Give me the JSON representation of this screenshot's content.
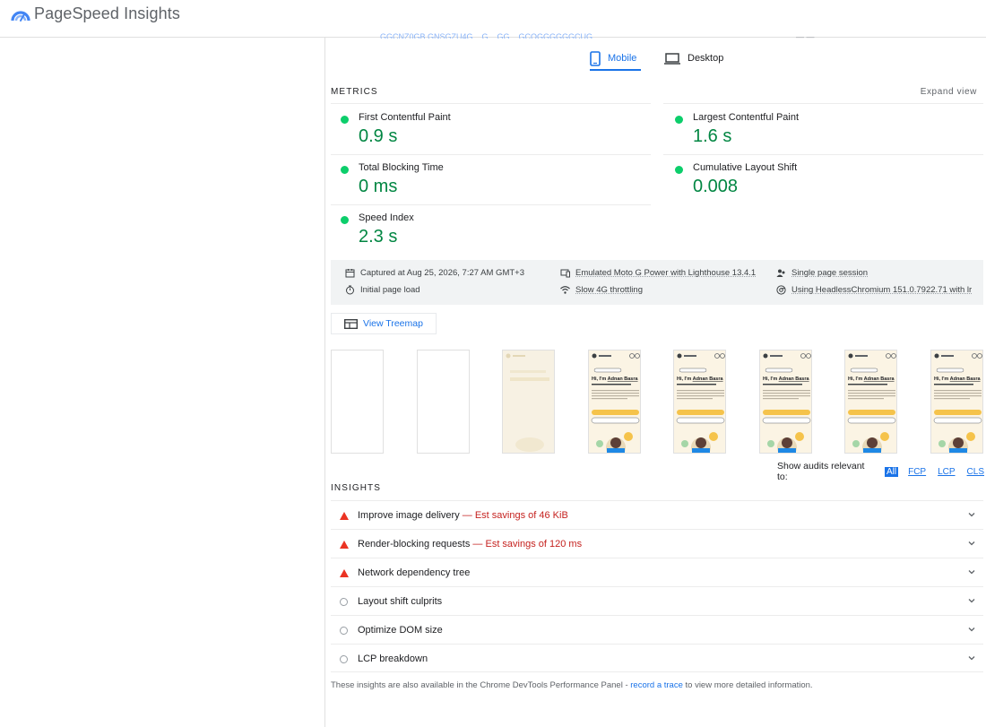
{
  "app": {
    "title": "PageSpeed Insights"
  },
  "top_clipped": {
    "left_text": "GGCNZ0GB GNSGZU4G... G... GG... GCOGGGGGGCUG...",
    "right_text": "— —"
  },
  "tabs": [
    {
      "label": "Mobile",
      "icon": "phone-icon",
      "active": true
    },
    {
      "label": "Desktop",
      "icon": "laptop-icon",
      "active": false
    }
  ],
  "metrics_section": {
    "label": "METRICS",
    "expand_label": "Expand view",
    "items": [
      {
        "label": "First Contentful Paint",
        "value": "0.9 s",
        "status": "pass"
      },
      {
        "label": "Largest Contentful Paint",
        "value": "1.6 s",
        "status": "pass"
      },
      {
        "label": "Total Blocking Time",
        "value": "0 ms",
        "status": "pass"
      },
      {
        "label": "Cumulative Layout Shift",
        "value": "0.008",
        "status": "pass"
      },
      {
        "label": "Speed Index",
        "value": "2.3 s",
        "status": "pass"
      }
    ],
    "pass_color": "#0cce6b",
    "value_color": "#018642"
  },
  "run_info": {
    "captured": "Captured at Aug 25, 2026, 7:27 AM GMT+3",
    "page_load": "Initial page load",
    "device": "Emulated Moto G Power with Lighthouse 13.4.1",
    "throttling": "Slow 4G throttling",
    "session": "Single page session",
    "browser": "Using HeadlessChromium 151.0.7922.71 with lr"
  },
  "treemap": {
    "label": "View Treemap"
  },
  "filmstrip": {
    "frames": [
      {
        "state": "blank"
      },
      {
        "state": "blank"
      },
      {
        "state": "loading"
      },
      {
        "state": "loaded"
      },
      {
        "state": "loaded"
      },
      {
        "state": "loaded"
      },
      {
        "state": "loaded"
      },
      {
        "state": "loaded"
      }
    ],
    "headline_prefix": "Hi, I'm",
    "headline_name": "Adnan Basra"
  },
  "audit_filters": {
    "label": "Show audits relevant to:",
    "options": [
      "All",
      "FCP",
      "LCP",
      "CLS"
    ],
    "active": "All"
  },
  "insights_section": {
    "label": "INSIGHTS",
    "items": [
      {
        "title": "Improve image delivery",
        "savings": "— Est savings of 46 KiB",
        "severity": "fail"
      },
      {
        "title": "Render-blocking requests",
        "savings": "— Est savings of 120 ms",
        "severity": "fail"
      },
      {
        "title": "Network dependency tree",
        "savings": "",
        "severity": "fail"
      },
      {
        "title": "Layout shift culprits",
        "savings": "",
        "severity": "info"
      },
      {
        "title": "Optimize DOM size",
        "savings": "",
        "severity": "info"
      },
      {
        "title": "LCP breakdown",
        "savings": "",
        "severity": "info"
      }
    ],
    "fail_color": "#eb3323"
  },
  "footer": {
    "prefix": "These insights are also available in the Chrome DevTools Performance Panel - ",
    "link": "record a trace",
    "suffix": " to view more detailed information."
  }
}
